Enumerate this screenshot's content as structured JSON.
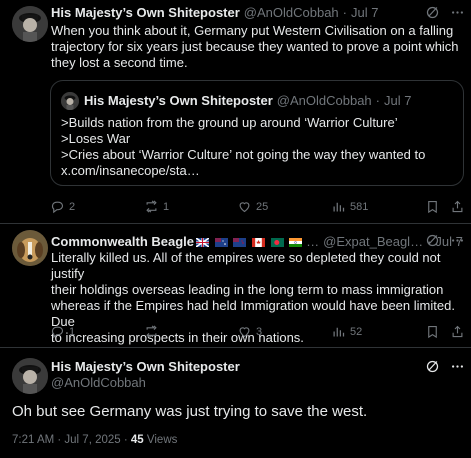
{
  "tweet1": {
    "name": "His Majesty’s Own Shiteposter",
    "handle": "@AnOldCobbah",
    "dot": "·",
    "date": "Jul 7",
    "lines": [
      "When you think about it, Germany put Western Civilisation on a falling",
      "trajectory for six years just because they wanted to prove a point which",
      "they lost a second time."
    ],
    "quote": {
      "name": "His Majesty’s Own Shiteposter",
      "handle": "@AnOldCobbah",
      "dot": "·",
      "date": "Jul 7",
      "lines": [
        ">Builds nation from the ground up around ‘Warrior Culture’",
        ">Loses War",
        ">Cries about ‘Warrior Culture’ not going the way they wanted to",
        "x.com/insanecope/sta…"
      ]
    },
    "stats": {
      "replies": "2",
      "reposts": "1",
      "likes": "25",
      "views": "581"
    }
  },
  "tweet2": {
    "name": "Commonwealth Beagle",
    "handle": "@Expat_Beagl…",
    "dot": "·",
    "date": "Jul 7",
    "lines": [
      "Literally killed us. All of the empires were so depleted they could not justify",
      "their holdings overseas leading in the long term to mass immigration",
      "whereas if the Empires had held Immigration would have been limited.  Due",
      "to increasing prospects in their own nations."
    ],
    "stats": {
      "replies": "1",
      "reposts": "",
      "likes": "3",
      "views": "52"
    }
  },
  "tweet3": {
    "name": "His Majesty’s Own Shiteposter",
    "handle": "@AnOldCobbah",
    "text": "Oh but see Germany was just trying to save the west.",
    "time": "7:21 AM · Jul 7, 2025 ·",
    "views_count": "45",
    "views_label": "Views"
  },
  "colors": {
    "background": "#000000",
    "text": "#e7e9ea",
    "muted": "#71767b",
    "border": "#2f3336"
  }
}
